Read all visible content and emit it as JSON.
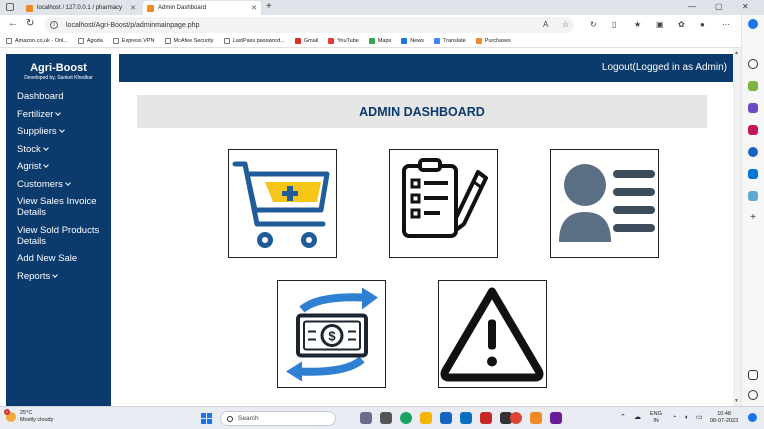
{
  "browser": {
    "tabs": [
      {
        "label": "localhost / 127.0.0.1 / pharmacy",
        "icon": "phpmyadmin-icon"
      },
      {
        "label": "Admin Dashboard",
        "icon": "site-icon",
        "active": true
      }
    ],
    "new_tab": "+",
    "window_controls": {
      "minimize": "—",
      "maximize": "▢",
      "close": "✕"
    },
    "url": "localhost/Agri-Boost/p/adminmainpage.php",
    "bookmarks": [
      {
        "label": "Amazon.co.uk - Onl...",
        "icon": "page-icon"
      },
      {
        "label": "Agoda",
        "icon": "page-icon"
      },
      {
        "label": "Express VPN",
        "icon": "page-icon"
      },
      {
        "label": "McAfee Security",
        "icon": "page-icon"
      },
      {
        "label": "LastPass password...",
        "icon": "page-icon"
      },
      {
        "label": "Gmail",
        "icon": "gmail-icon"
      },
      {
        "label": "YouTube",
        "icon": "youtube-icon"
      },
      {
        "label": "Maps",
        "icon": "maps-icon"
      },
      {
        "label": "News",
        "icon": "news-icon"
      },
      {
        "label": "Translate",
        "icon": "translate-icon"
      },
      {
        "label": "Purchases",
        "icon": "purchases-icon"
      }
    ]
  },
  "app": {
    "brand": "Agri-Boost",
    "subtitle": "Developed by, Sanket Khedkar",
    "logout": "Logout(Logged in as Admin)",
    "heading": "ADMIN DASHBOARD",
    "menu": [
      {
        "label": "Dashboard",
        "has_dropdown": false
      },
      {
        "label": "Fertilizer",
        "has_dropdown": true
      },
      {
        "label": "Suppliers",
        "has_dropdown": true
      },
      {
        "label": "Stock",
        "has_dropdown": true
      },
      {
        "label": "Agrist",
        "has_dropdown": true
      },
      {
        "label": "Customers",
        "has_dropdown": true
      },
      {
        "label": "View Sales Invoice Details",
        "has_dropdown": false
      },
      {
        "label": "View Sold Products Details",
        "has_dropdown": false
      },
      {
        "label": "Add New Sale",
        "has_dropdown": false
      },
      {
        "label": "Reports",
        "has_dropdown": true
      }
    ],
    "tiles": [
      {
        "name": "shopping-cart-add-icon"
      },
      {
        "name": "clipboard-checklist-icon"
      },
      {
        "name": "user-profile-icon"
      },
      {
        "name": "money-exchange-icon"
      },
      {
        "name": "warning-icon"
      }
    ],
    "colors": {
      "navy": "#0b3a6c",
      "heading_bg": "#e6e6e6",
      "cart_yellow": "#f5c518",
      "cart_blue": "#1f5c99",
      "user_gray": "#5b7085"
    }
  },
  "taskbar": {
    "weather_temp": "25°C",
    "weather_desc": "Mostly cloudy",
    "weather_badge": "1",
    "search_placeholder": "Search",
    "lang_line1": "ENG",
    "lang_line2": "IN",
    "time": "10:48",
    "date": "08-07-2023"
  }
}
